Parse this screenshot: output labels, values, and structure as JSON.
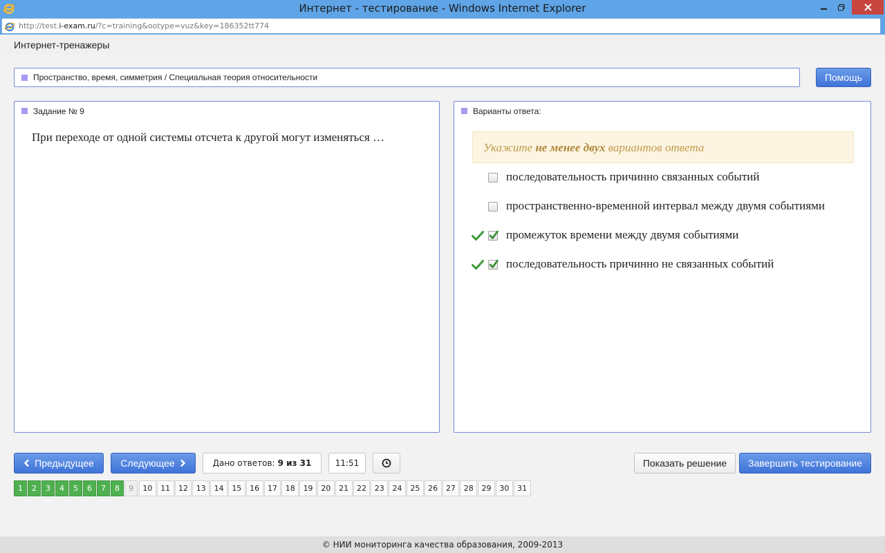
{
  "window": {
    "title": "Интернет - тестирование - Windows Internet Explorer",
    "url_prefix": "http://test.",
    "url_host": "i-exam.ru",
    "url_rest": "/?c=training&ootype=vuz&key=186352tt774"
  },
  "header": {
    "title": "Интернет-тренажеры"
  },
  "topic": {
    "text": "Пространство, время, симметрия / Специальная теория относительности"
  },
  "help_button": "Помощь",
  "task": {
    "title": "Задание № 9",
    "question": "При переходе от одной системы отсчета к другой могут изменяться …"
  },
  "answers": {
    "title": "Варианты ответа:",
    "hint_pre": "Укажите ",
    "hint_bold": "не менее двух",
    "hint_post": " вариантов ответа",
    "options": [
      {
        "label": "последовательность причинно связанных событий",
        "checked": false,
        "correct_mark": false
      },
      {
        "label": "пространственно-временной интервал между двумя событиями",
        "checked": false,
        "correct_mark": false
      },
      {
        "label": "промежуток времени между двумя событиями",
        "checked": true,
        "correct_mark": true
      },
      {
        "label": "последовательность причинно не связанных событий",
        "checked": true,
        "correct_mark": true
      }
    ]
  },
  "nav": {
    "prev": "Предыдущее",
    "next": "Следующее",
    "answers_label": "Дано ответов:",
    "answers_value": "9 из 31",
    "timer": "11:51",
    "show_solution": "Показать решение",
    "finish": "Завершить тестирование"
  },
  "pager": {
    "done": [
      "1",
      "2",
      "3",
      "4",
      "5",
      "6",
      "7",
      "8"
    ],
    "current": "9",
    "todo": [
      "10",
      "11",
      "12",
      "13",
      "14",
      "15",
      "16",
      "17",
      "18",
      "19",
      "20",
      "21",
      "22",
      "23",
      "24",
      "25",
      "26",
      "27",
      "28",
      "29",
      "30",
      "31"
    ]
  },
  "footer": "© НИИ мониторинга качества образования, 2009-2013",
  "colors": {
    "accent_blue": "#4a7fe0",
    "done_green": "#4fb04f",
    "hint_bg": "#fdf5e2",
    "marker_purple": "#a49cf2"
  },
  "icons": {
    "browser": "ie-icon",
    "minimize": "minimize-icon",
    "maximize": "restore-icon",
    "close": "close-icon",
    "prev": "chevron-left-icon",
    "next": "chevron-right-icon",
    "clock": "clock-icon",
    "correct": "checkmark-icon"
  }
}
